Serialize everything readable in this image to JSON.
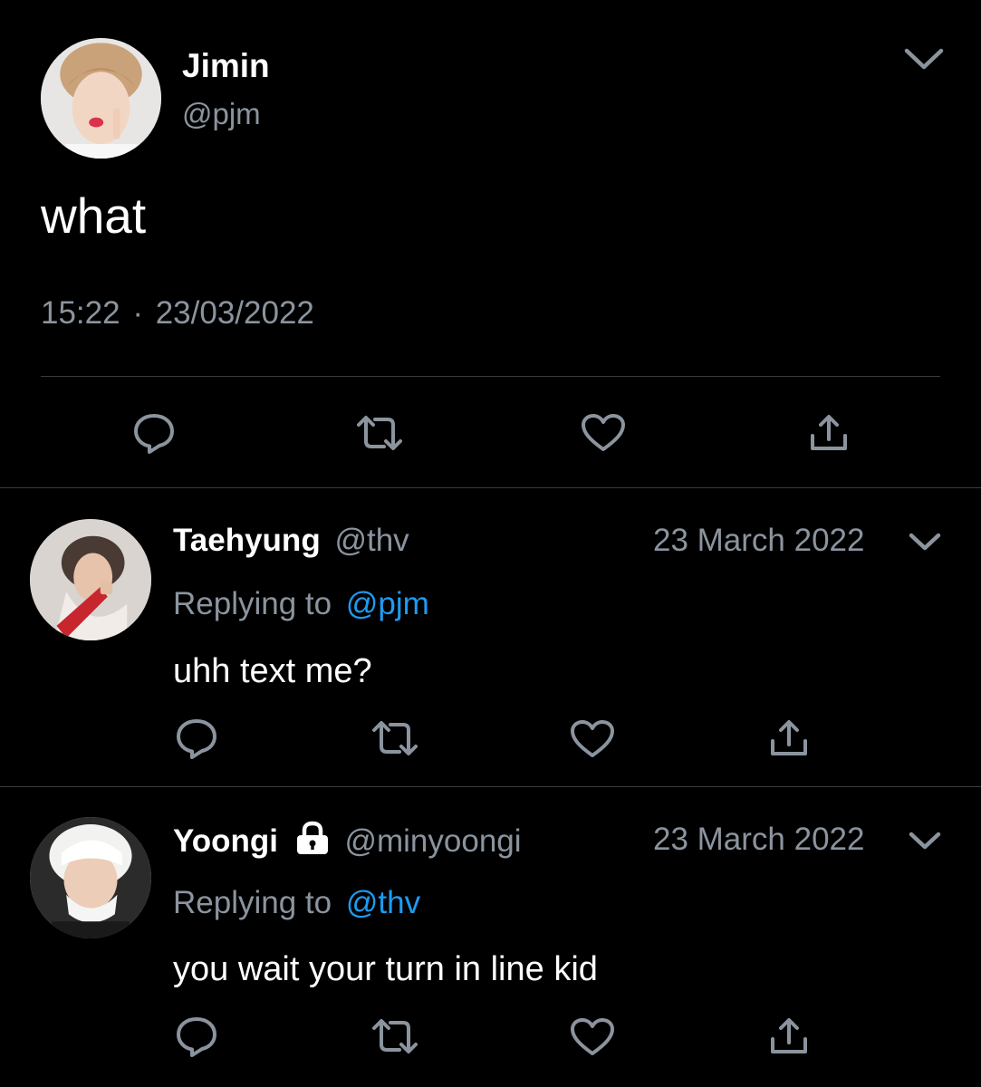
{
  "main_tweet": {
    "display_name": "Jimin",
    "handle": "@pjm",
    "text": "what",
    "time": "15:22",
    "separator": "·",
    "date": "23/03/2022",
    "avatar_icon": "avatar-photo-jimin",
    "menu_icon": "chevron-down-icon"
  },
  "actions": {
    "reply_icon": "reply-icon",
    "retweet_icon": "retweet-icon",
    "like_icon": "heart-icon",
    "share_icon": "share-icon"
  },
  "replies": [
    {
      "display_name": "Taehyung",
      "handle": "@thv",
      "date": "23 March 2022",
      "replying_prefix": "Replying to",
      "replying_to": "@pjm",
      "text": "uhh text me?",
      "protected": false
    },
    {
      "display_name": "Yoongi",
      "handle": "@minyoongi",
      "date": "23 March 2022",
      "replying_prefix": "Replying to",
      "replying_to": "@thv",
      "text": "you wait your turn in line kid",
      "protected": true,
      "protected_icon": "lock-icon"
    }
  ],
  "colors": {
    "background": "#000000",
    "text": "#ffffff",
    "secondary": "#8b949e",
    "link": "#1d9bf0",
    "divider": "#3a3d41"
  }
}
